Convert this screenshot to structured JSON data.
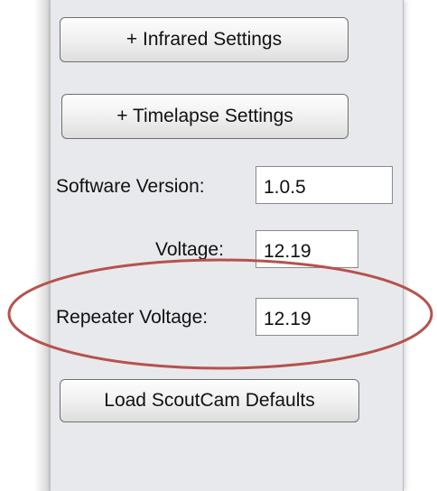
{
  "buttons": {
    "infrared": "+ Infrared Settings",
    "timelapse": "+ Timelapse Settings",
    "load_defaults": "Load ScoutCam Defaults"
  },
  "fields": {
    "software_version": {
      "label": "Software Version:",
      "value": "1.0.5"
    },
    "voltage": {
      "label": "Voltage:",
      "value": "12.19"
    },
    "repeater_voltage": {
      "label": "Repeater Voltage:",
      "value": "12.19"
    }
  },
  "annotation": {
    "highlight_color": "#b5524d",
    "highlights": "repeater-voltage-row"
  },
  "colors": {
    "panel_background": "#e8e9ec",
    "button_border": "#6f6f6f"
  }
}
